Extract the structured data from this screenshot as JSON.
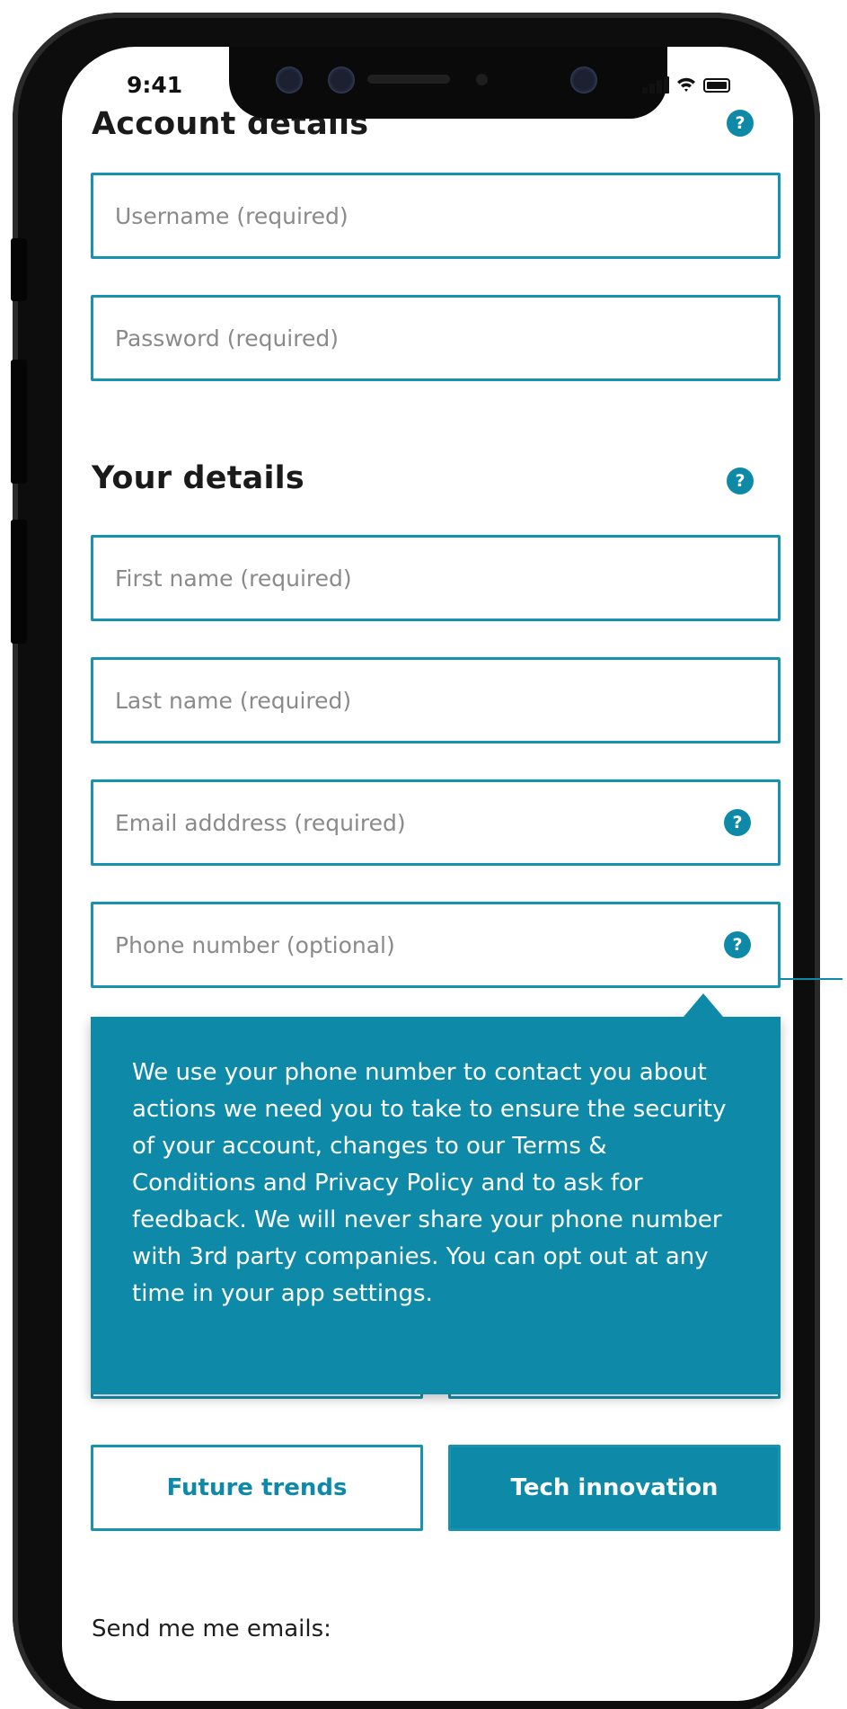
{
  "status_bar": {
    "time": "9:41"
  },
  "account_section": {
    "heading": "Account details",
    "help_icon": "?",
    "username_placeholder": "Username (required)",
    "password_placeholder": "Password (required)"
  },
  "your_details_section": {
    "heading": "Your details",
    "help_icon": "?",
    "first_name_placeholder": "First name (required)",
    "last_name_placeholder": "Last name (required)",
    "email_placeholder": "Email adddress (required)",
    "email_help_icon": "?",
    "phone_placeholder": "Phone number (optional)",
    "phone_help_icon": "?"
  },
  "tooltip": {
    "text": "We use your phone number to contact you about actions we need you to take to ensure the security of your account, changes to our Terms & Conditions and Privacy Policy and to ask for feedback. We will never share your phone number with 3rd party companies. You can opt out at any time in your app settings."
  },
  "interests": {
    "future_trends": "Future trends",
    "tech_innovation": "Tech innovation"
  },
  "emails_label": "Send me me emails:",
  "colors": {
    "accent": "#0e8aa8",
    "field_border": "#1693b0",
    "text_dark": "#1a1a1a",
    "placeholder": "#8a8a8a",
    "frame": "#0d0d0d"
  },
  "icons": {
    "help": "question-circle-icon",
    "signal": "cellular-signal-icon",
    "wifi": "wifi-icon",
    "battery": "battery-icon"
  }
}
